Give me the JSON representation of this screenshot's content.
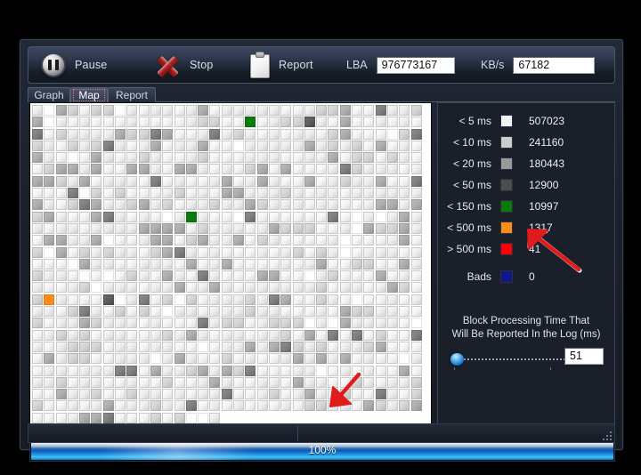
{
  "window": {
    "toolbar": {
      "pause_label": "Pause",
      "stop_label": "Stop",
      "report_label": "Report",
      "lba_label": "LBA",
      "lba_value": "976773167",
      "kbs_label": "KB/s",
      "kbs_value": "67182"
    },
    "tabs": [
      {
        "label": "Graph",
        "selected": false
      },
      {
        "label": "Map",
        "selected": true
      },
      {
        "label": "Report",
        "selected": false
      }
    ],
    "legend": {
      "rows": [
        {
          "name": "< 5 ms",
          "color": "#f2f2f2",
          "value": "507023"
        },
        {
          "name": "< 10 ms",
          "color": "#cccccc",
          "value": "241160"
        },
        {
          "name": "< 20 ms",
          "color": "#9a9a9a",
          "value": "180443"
        },
        {
          "name": "< 50 ms",
          "color": "#4d4d4d",
          "value": "12900"
        },
        {
          "name": "< 150 ms",
          "color": "#0a7a0a",
          "value": "10997"
        },
        {
          "name": "< 500 ms",
          "color": "#ff8c19",
          "value": "1317"
        },
        {
          "name": "> 500 ms",
          "color": "#ff0000",
          "value": "41"
        }
      ],
      "bads": {
        "name": "Bads",
        "color": "#111688",
        "value": "0"
      }
    },
    "block_time": {
      "caption_line1": "Block Processing Time That",
      "caption_line2": "Will Be Reported In the Log (ms)",
      "value": "51"
    },
    "progress": {
      "text": "100%",
      "percent": 100
    }
  },
  "map": {
    "columns": 33,
    "rows": 27,
    "last_row_columns": 16,
    "cells": "generated",
    "markers": [
      {
        "row": 1,
        "col": 18,
        "type": "green"
      },
      {
        "row": 1,
        "col": 23,
        "type": "g5"
      },
      {
        "row": 9,
        "col": 13,
        "type": "green"
      },
      {
        "row": 16,
        "col": 1,
        "type": "orange"
      },
      {
        "row": 16,
        "col": 6,
        "type": "g5"
      }
    ]
  }
}
